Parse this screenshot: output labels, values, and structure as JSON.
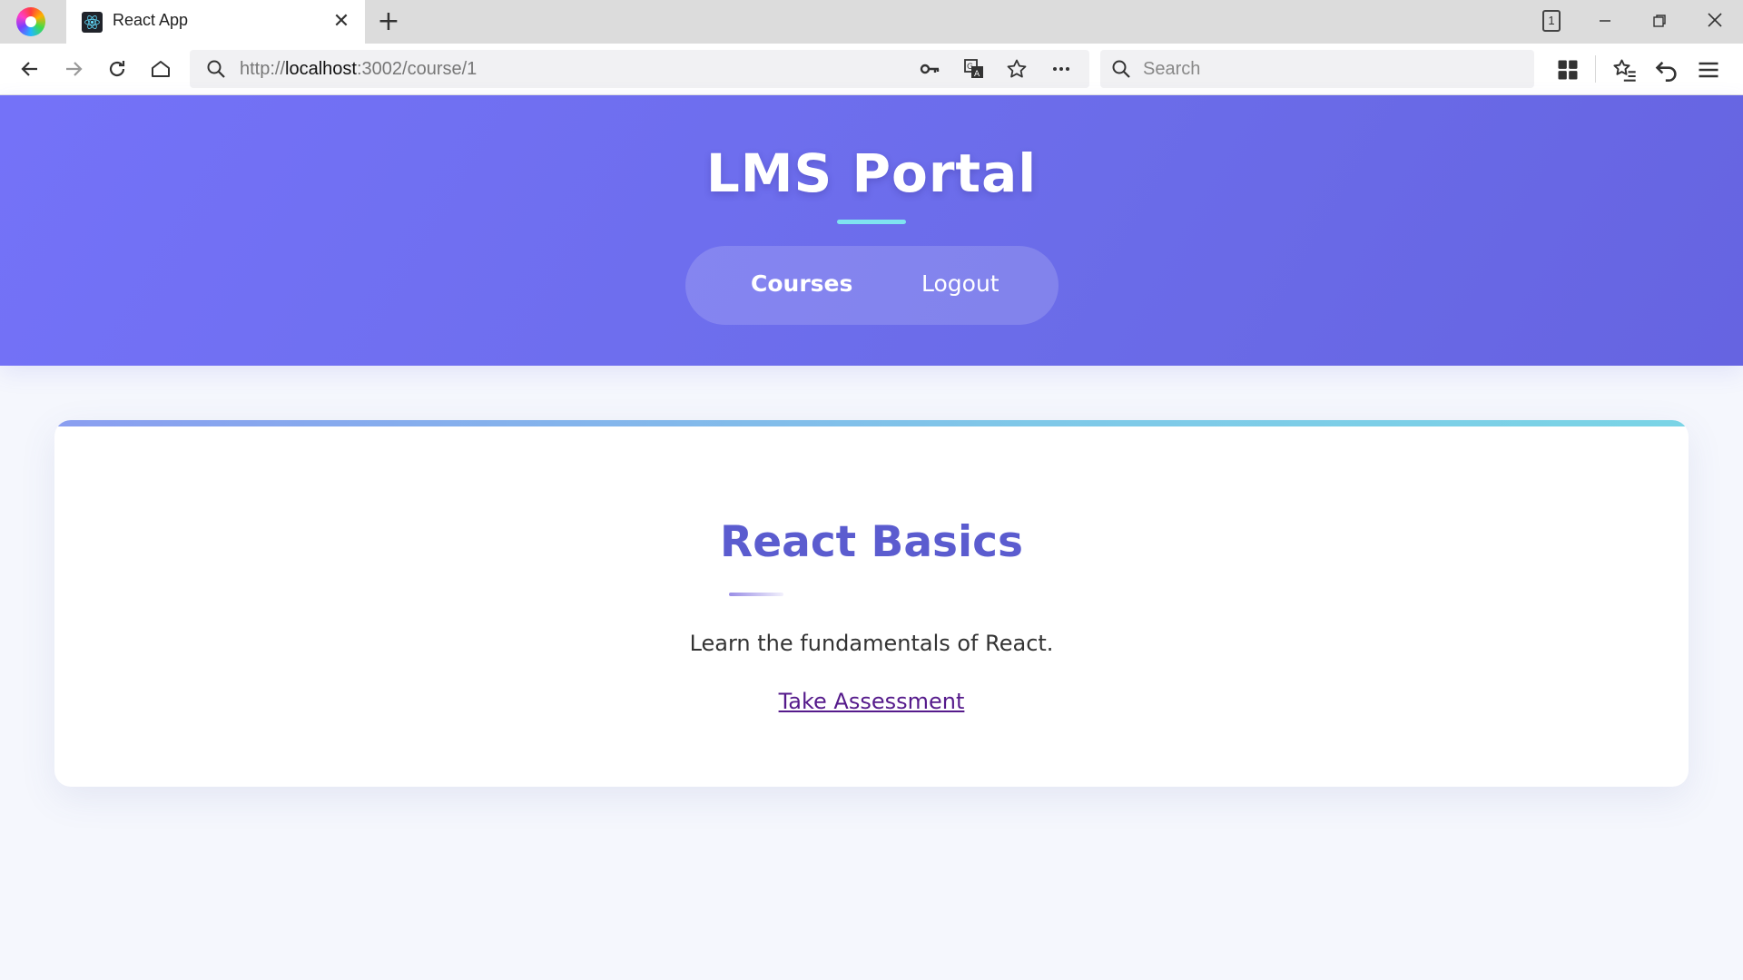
{
  "browser": {
    "tab_title": "React App",
    "tab_count": "1",
    "url_prefix": "http://",
    "url_host": "localhost",
    "url_rest": ":3002/course/1",
    "search_placeholder": "Search",
    "icons": {
      "back": "arrow-left-icon",
      "forward": "arrow-right-icon",
      "reload": "reload-icon",
      "home": "home-icon",
      "key": "key-icon",
      "translate": "translate-icon",
      "bookmark": "star-icon",
      "more": "more-icon",
      "apps": "grid-icon",
      "favorites": "star-list-icon",
      "undo": "undo-icon",
      "menu": "menu-icon"
    }
  },
  "header": {
    "title": "LMS Portal",
    "nav": {
      "courses": "Courses",
      "logout": "Logout"
    }
  },
  "course": {
    "title": "React Basics",
    "description": "Learn the fundamentals of React.",
    "assessment_link": "Take Assessment"
  },
  "colors": {
    "header_gradient_start": "#7472f8",
    "header_gradient_end": "#6664e1",
    "accent_underline": "#7fe3f0",
    "course_title": "#5b5ccf",
    "link": "#551a8b",
    "page_bg": "#f5f7fd"
  }
}
